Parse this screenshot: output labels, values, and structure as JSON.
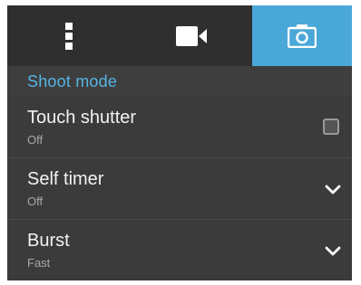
{
  "tabs": [
    {
      "icon": "more-vertical-icon",
      "active": false
    },
    {
      "icon": "video-camera-icon",
      "active": false
    },
    {
      "icon": "camera-icon",
      "active": true
    }
  ],
  "colors": {
    "accent": "#4aa8d8",
    "section_title": "#56b4e6",
    "background": "#3b3b3b",
    "tabbar": "#2f2f2f"
  },
  "section": {
    "title": "Shoot mode"
  },
  "settings": [
    {
      "title": "Touch shutter",
      "value": "Off",
      "control": "checkbox",
      "checked": false
    },
    {
      "title": "Self timer",
      "value": "Off",
      "control": "dropdown"
    },
    {
      "title": "Burst",
      "value": "Fast",
      "control": "dropdown"
    }
  ]
}
